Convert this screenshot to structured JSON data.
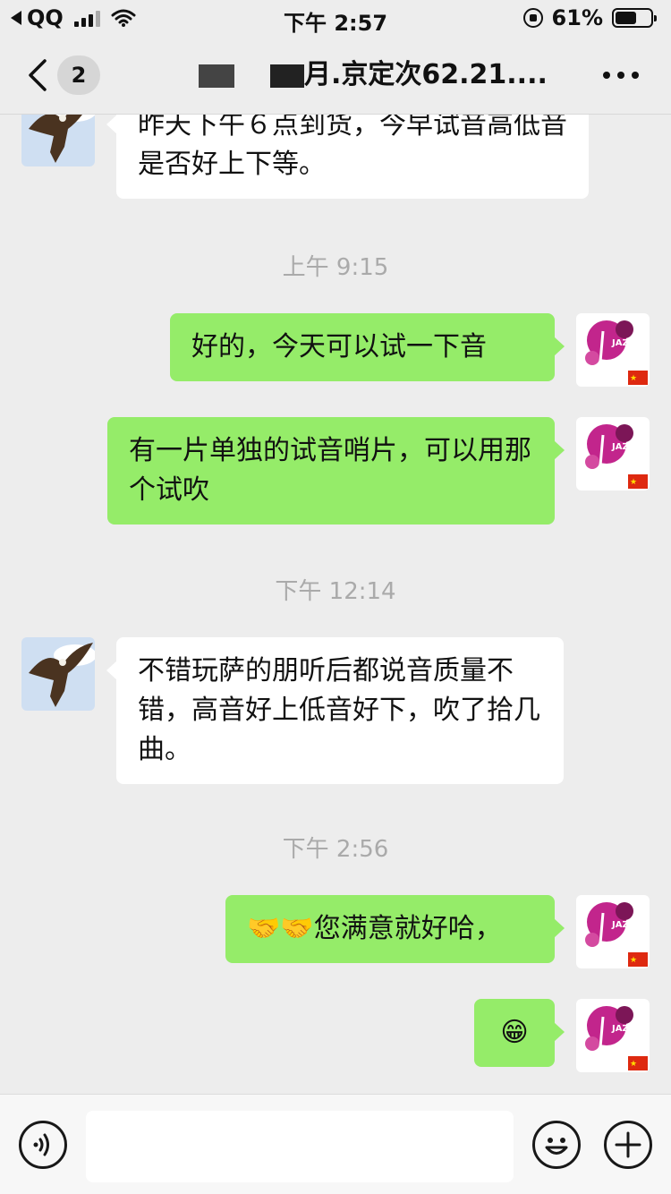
{
  "status_bar": {
    "carrier": "QQ",
    "time": "下午 2:57",
    "battery": "61%",
    "battery_level": 0.61
  },
  "nav": {
    "badge": "2",
    "title_visible": "月.京定次62.21...."
  },
  "messages": [
    {
      "side": "in",
      "text": "昨天下午６点到货，今早试音高低音是否好上下等。"
    },
    {
      "side": "time",
      "text": "上午 9:15"
    },
    {
      "side": "out",
      "text": "好的，今天可以试一下音"
    },
    {
      "side": "out",
      "text": "有一片单独的试音哨片，可以用那个试吹"
    },
    {
      "side": "time",
      "text": "下午 12:14"
    },
    {
      "side": "in",
      "text": "不错玩萨的朋听后都说音质量不错，高音好上低音好下，吹了拾几曲。"
    },
    {
      "side": "time",
      "text": "下午 2:56"
    },
    {
      "side": "out",
      "text": "🤝🤝您满意就好哈，"
    },
    {
      "side": "out",
      "text": "😁"
    }
  ],
  "input": {
    "placeholder": ""
  },
  "icons": {
    "voice": "voice-icon",
    "emoji": "emoji-icon",
    "plus": "plus-icon"
  }
}
